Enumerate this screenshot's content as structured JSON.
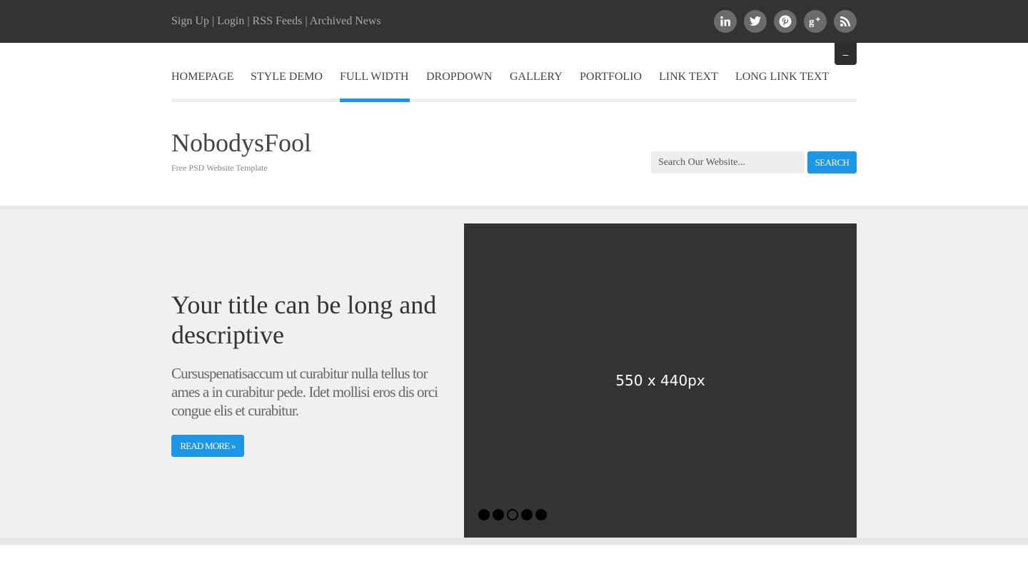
{
  "topbar": {
    "links": [
      "Sign Up",
      "Login",
      "RSS Feeds",
      "Archived News"
    ],
    "separator": "|",
    "social": [
      {
        "icon": "linkedin-icon"
      },
      {
        "icon": "twitter-icon"
      },
      {
        "icon": "pinterest-icon"
      },
      {
        "icon": "google-plus-icon"
      },
      {
        "icon": "rss-icon"
      }
    ],
    "toggle_label": "–"
  },
  "nav": {
    "items": [
      {
        "label": "HOMEPAGE"
      },
      {
        "label": "STYLE DEMO"
      },
      {
        "label": "FULL WIDTH",
        "active": true
      },
      {
        "label": "DROPDOWN"
      },
      {
        "label": "GALLERY"
      },
      {
        "label": "PORTFOLIO"
      },
      {
        "label": "LINK TEXT"
      },
      {
        "label": "LONG LINK TEXT"
      }
    ]
  },
  "header": {
    "title": "NobodysFool",
    "subtitle": "Free PSD Website Template",
    "search_placeholder": "Search Our Website...",
    "search_button": "SEARCH"
  },
  "hero": {
    "title": "Your title can be long and descriptive",
    "text": "Cursuspenatisaccum ut curabitur nulla tellus tor ames a in curabitur pede. Idet mollisi eros dis orci congue elis et curabitur.",
    "button": "READ MORE »",
    "slide_label": "550 x 440px",
    "slide_count": 5,
    "active_slide": 3
  },
  "colors": {
    "accent": "#1e96e6",
    "topbar": "#333333",
    "hero_bg": "#f0f0f0"
  }
}
